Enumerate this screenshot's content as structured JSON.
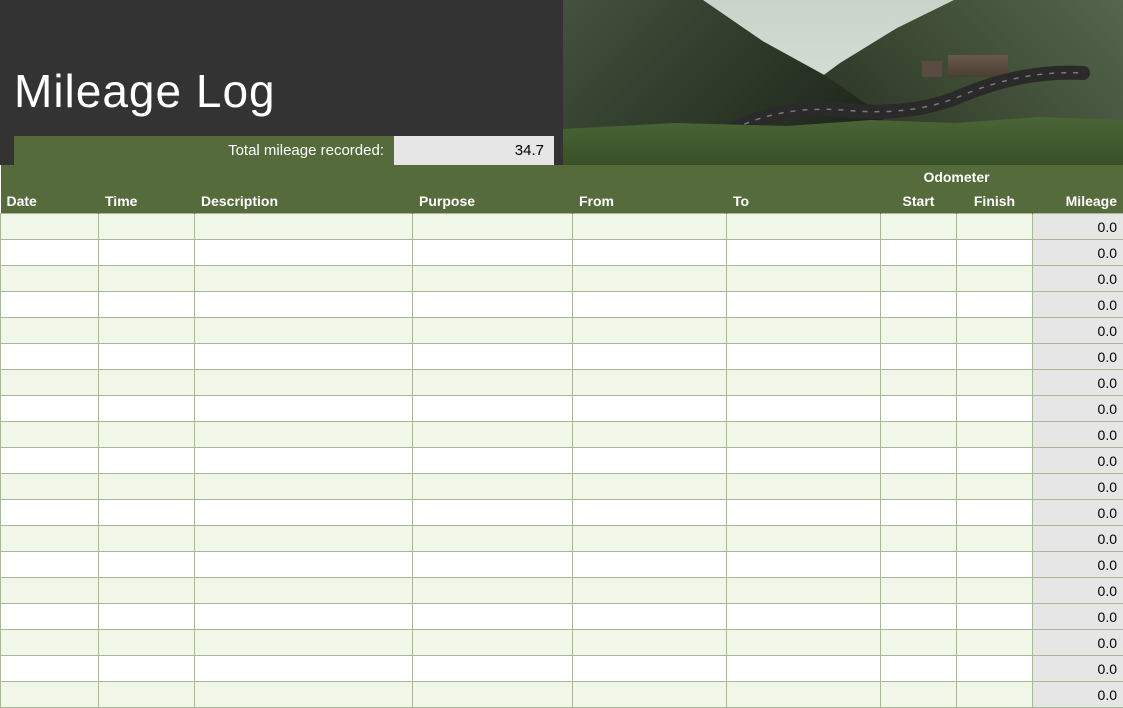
{
  "title": "Mileage Log",
  "totals": {
    "label": "Total mileage recorded:",
    "value": "34.7"
  },
  "columns": {
    "date": "Date",
    "time": "Time",
    "description": "Description",
    "purpose": "Purpose",
    "from": "From",
    "to": "To",
    "odometer_group": "Odometer",
    "start": "Start",
    "finish": "Finish",
    "mileage": "Mileage"
  },
  "rows": [
    {
      "date": "",
      "time": "",
      "description": "",
      "purpose": "",
      "from": "",
      "to": "",
      "start": "",
      "finish": "",
      "mileage": "0.0"
    },
    {
      "date": "",
      "time": "",
      "description": "",
      "purpose": "",
      "from": "",
      "to": "",
      "start": "",
      "finish": "",
      "mileage": "0.0"
    },
    {
      "date": "",
      "time": "",
      "description": "",
      "purpose": "",
      "from": "",
      "to": "",
      "start": "",
      "finish": "",
      "mileage": "0.0"
    },
    {
      "date": "",
      "time": "",
      "description": "",
      "purpose": "",
      "from": "",
      "to": "",
      "start": "",
      "finish": "",
      "mileage": "0.0"
    },
    {
      "date": "",
      "time": "",
      "description": "",
      "purpose": "",
      "from": "",
      "to": "",
      "start": "",
      "finish": "",
      "mileage": "0.0"
    },
    {
      "date": "",
      "time": "",
      "description": "",
      "purpose": "",
      "from": "",
      "to": "",
      "start": "",
      "finish": "",
      "mileage": "0.0"
    },
    {
      "date": "",
      "time": "",
      "description": "",
      "purpose": "",
      "from": "",
      "to": "",
      "start": "",
      "finish": "",
      "mileage": "0.0"
    },
    {
      "date": "",
      "time": "",
      "description": "",
      "purpose": "",
      "from": "",
      "to": "",
      "start": "",
      "finish": "",
      "mileage": "0.0"
    },
    {
      "date": "",
      "time": "",
      "description": "",
      "purpose": "",
      "from": "",
      "to": "",
      "start": "",
      "finish": "",
      "mileage": "0.0"
    },
    {
      "date": "",
      "time": "",
      "description": "",
      "purpose": "",
      "from": "",
      "to": "",
      "start": "",
      "finish": "",
      "mileage": "0.0"
    },
    {
      "date": "",
      "time": "",
      "description": "",
      "purpose": "",
      "from": "",
      "to": "",
      "start": "",
      "finish": "",
      "mileage": "0.0"
    },
    {
      "date": "",
      "time": "",
      "description": "",
      "purpose": "",
      "from": "",
      "to": "",
      "start": "",
      "finish": "",
      "mileage": "0.0"
    },
    {
      "date": "",
      "time": "",
      "description": "",
      "purpose": "",
      "from": "",
      "to": "",
      "start": "",
      "finish": "",
      "mileage": "0.0"
    },
    {
      "date": "",
      "time": "",
      "description": "",
      "purpose": "",
      "from": "",
      "to": "",
      "start": "",
      "finish": "",
      "mileage": "0.0"
    },
    {
      "date": "",
      "time": "",
      "description": "",
      "purpose": "",
      "from": "",
      "to": "",
      "start": "",
      "finish": "",
      "mileage": "0.0"
    },
    {
      "date": "",
      "time": "",
      "description": "",
      "purpose": "",
      "from": "",
      "to": "",
      "start": "",
      "finish": "",
      "mileage": "0.0"
    },
    {
      "date": "",
      "time": "",
      "description": "",
      "purpose": "",
      "from": "",
      "to": "",
      "start": "",
      "finish": "",
      "mileage": "0.0"
    },
    {
      "date": "",
      "time": "",
      "description": "",
      "purpose": "",
      "from": "",
      "to": "",
      "start": "",
      "finish": "",
      "mileage": "0.0"
    },
    {
      "date": "",
      "time": "",
      "description": "",
      "purpose": "",
      "from": "",
      "to": "",
      "start": "",
      "finish": "",
      "mileage": "0.0"
    }
  ]
}
